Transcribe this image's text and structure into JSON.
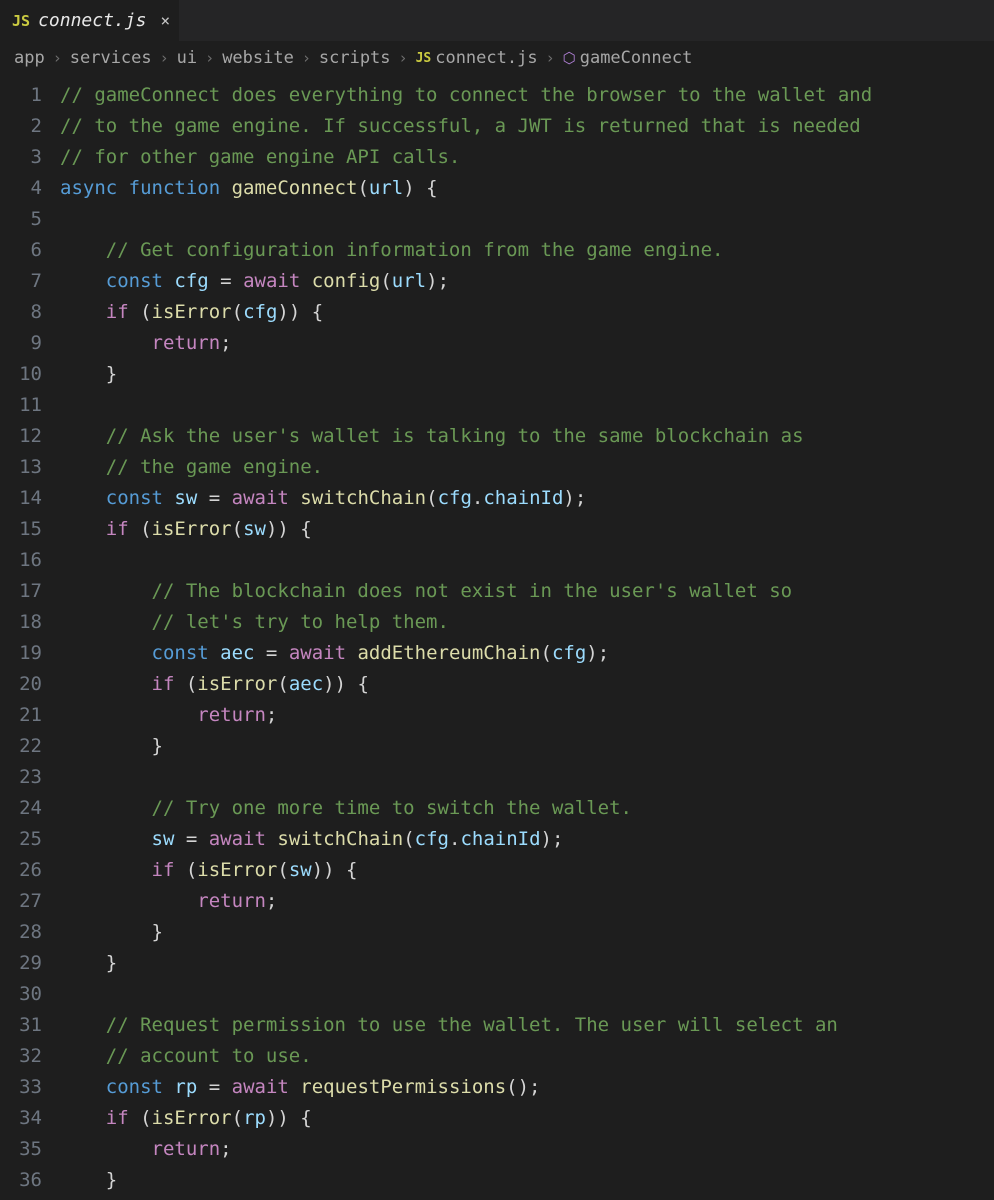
{
  "tab": {
    "icon_label": "JS",
    "filename": "connect.js",
    "close_glyph": "×"
  },
  "breadcrumbs": {
    "sep": "›",
    "parts": [
      "app",
      "services",
      "ui",
      "website",
      "scripts"
    ],
    "file_icon": "JS",
    "file": "connect.js",
    "symbol_icon": "⬡",
    "symbol": "gameConnect"
  },
  "code": {
    "lines": [
      {
        "n": 1,
        "tokens": [
          {
            "c": "tok-comment",
            "t": "// gameConnect does everything to connect the browser to the wallet and"
          }
        ]
      },
      {
        "n": 2,
        "tokens": [
          {
            "c": "tok-comment",
            "t": "// to the game engine. If successful, a JWT is returned that is needed"
          }
        ]
      },
      {
        "n": 3,
        "tokens": [
          {
            "c": "tok-comment",
            "t": "// for other game engine API calls."
          }
        ]
      },
      {
        "n": 4,
        "tokens": [
          {
            "c": "tok-keyword",
            "t": "async "
          },
          {
            "c": "tok-keyword",
            "t": "function "
          },
          {
            "c": "tok-func",
            "t": "gameConnect"
          },
          {
            "c": "tok-punct",
            "t": "("
          },
          {
            "c": "tok-ident",
            "t": "url"
          },
          {
            "c": "tok-punct",
            "t": ") {"
          }
        ]
      },
      {
        "n": 5,
        "tokens": [
          {
            "c": "tok-punct",
            "t": ""
          }
        ]
      },
      {
        "n": 6,
        "tokens": [
          {
            "c": "tok-punct",
            "t": "    "
          },
          {
            "c": "tok-comment",
            "t": "// Get configuration information from the game engine."
          }
        ]
      },
      {
        "n": 7,
        "tokens": [
          {
            "c": "tok-punct",
            "t": "    "
          },
          {
            "c": "tok-keyword",
            "t": "const "
          },
          {
            "c": "tok-ident",
            "t": "cfg"
          },
          {
            "c": "tok-punct",
            "t": " = "
          },
          {
            "c": "tok-storage",
            "t": "await "
          },
          {
            "c": "tok-func",
            "t": "config"
          },
          {
            "c": "tok-punct",
            "t": "("
          },
          {
            "c": "tok-ident",
            "t": "url"
          },
          {
            "c": "tok-punct",
            "t": ");"
          }
        ]
      },
      {
        "n": 8,
        "tokens": [
          {
            "c": "tok-punct",
            "t": "    "
          },
          {
            "c": "tok-storage",
            "t": "if "
          },
          {
            "c": "tok-punct",
            "t": "("
          },
          {
            "c": "tok-func",
            "t": "isError"
          },
          {
            "c": "tok-punct",
            "t": "("
          },
          {
            "c": "tok-ident",
            "t": "cfg"
          },
          {
            "c": "tok-punct",
            "t": ")) {"
          }
        ]
      },
      {
        "n": 9,
        "tokens": [
          {
            "c": "tok-punct",
            "t": "        "
          },
          {
            "c": "tok-storage",
            "t": "return"
          },
          {
            "c": "tok-punct",
            "t": ";"
          }
        ]
      },
      {
        "n": 10,
        "tokens": [
          {
            "c": "tok-punct",
            "t": "    }"
          }
        ]
      },
      {
        "n": 11,
        "tokens": [
          {
            "c": "tok-punct",
            "t": ""
          }
        ]
      },
      {
        "n": 12,
        "tokens": [
          {
            "c": "tok-punct",
            "t": "    "
          },
          {
            "c": "tok-comment",
            "t": "// Ask the user's wallet is talking to the same blockchain as"
          }
        ]
      },
      {
        "n": 13,
        "tokens": [
          {
            "c": "tok-punct",
            "t": "    "
          },
          {
            "c": "tok-comment",
            "t": "// the game engine."
          }
        ]
      },
      {
        "n": 14,
        "tokens": [
          {
            "c": "tok-punct",
            "t": "    "
          },
          {
            "c": "tok-keyword",
            "t": "const "
          },
          {
            "c": "tok-ident",
            "t": "sw"
          },
          {
            "c": "tok-punct",
            "t": " = "
          },
          {
            "c": "tok-storage",
            "t": "await "
          },
          {
            "c": "tok-func",
            "t": "switchChain"
          },
          {
            "c": "tok-punct",
            "t": "("
          },
          {
            "c": "tok-ident",
            "t": "cfg"
          },
          {
            "c": "tok-punct",
            "t": "."
          },
          {
            "c": "tok-prop",
            "t": "chainId"
          },
          {
            "c": "tok-punct",
            "t": ");"
          }
        ]
      },
      {
        "n": 15,
        "tokens": [
          {
            "c": "tok-punct",
            "t": "    "
          },
          {
            "c": "tok-storage",
            "t": "if "
          },
          {
            "c": "tok-punct",
            "t": "("
          },
          {
            "c": "tok-func",
            "t": "isError"
          },
          {
            "c": "tok-punct",
            "t": "("
          },
          {
            "c": "tok-ident",
            "t": "sw"
          },
          {
            "c": "tok-punct",
            "t": ")) {"
          }
        ]
      },
      {
        "n": 16,
        "tokens": [
          {
            "c": "tok-punct",
            "t": ""
          }
        ]
      },
      {
        "n": 17,
        "tokens": [
          {
            "c": "tok-punct",
            "t": "        "
          },
          {
            "c": "tok-comment",
            "t": "// The blockchain does not exist in the user's wallet so"
          }
        ]
      },
      {
        "n": 18,
        "tokens": [
          {
            "c": "tok-punct",
            "t": "        "
          },
          {
            "c": "tok-comment",
            "t": "// let's try to help them."
          }
        ]
      },
      {
        "n": 19,
        "tokens": [
          {
            "c": "tok-punct",
            "t": "        "
          },
          {
            "c": "tok-keyword",
            "t": "const "
          },
          {
            "c": "tok-ident",
            "t": "aec"
          },
          {
            "c": "tok-punct",
            "t": " = "
          },
          {
            "c": "tok-storage",
            "t": "await "
          },
          {
            "c": "tok-func",
            "t": "addEthereumChain"
          },
          {
            "c": "tok-punct",
            "t": "("
          },
          {
            "c": "tok-ident",
            "t": "cfg"
          },
          {
            "c": "tok-punct",
            "t": ");"
          }
        ]
      },
      {
        "n": 20,
        "tokens": [
          {
            "c": "tok-punct",
            "t": "        "
          },
          {
            "c": "tok-storage",
            "t": "if "
          },
          {
            "c": "tok-punct",
            "t": "("
          },
          {
            "c": "tok-func",
            "t": "isError"
          },
          {
            "c": "tok-punct",
            "t": "("
          },
          {
            "c": "tok-ident",
            "t": "aec"
          },
          {
            "c": "tok-punct",
            "t": ")) {"
          }
        ]
      },
      {
        "n": 21,
        "tokens": [
          {
            "c": "tok-punct",
            "t": "            "
          },
          {
            "c": "tok-storage",
            "t": "return"
          },
          {
            "c": "tok-punct",
            "t": ";"
          }
        ]
      },
      {
        "n": 22,
        "tokens": [
          {
            "c": "tok-punct",
            "t": "        }"
          }
        ]
      },
      {
        "n": 23,
        "tokens": [
          {
            "c": "tok-punct",
            "t": ""
          }
        ]
      },
      {
        "n": 24,
        "tokens": [
          {
            "c": "tok-punct",
            "t": "        "
          },
          {
            "c": "tok-comment",
            "t": "// Try one more time to switch the wallet."
          }
        ]
      },
      {
        "n": 25,
        "tokens": [
          {
            "c": "tok-punct",
            "t": "        "
          },
          {
            "c": "tok-ident",
            "t": "sw"
          },
          {
            "c": "tok-punct",
            "t": " = "
          },
          {
            "c": "tok-storage",
            "t": "await "
          },
          {
            "c": "tok-func",
            "t": "switchChain"
          },
          {
            "c": "tok-punct",
            "t": "("
          },
          {
            "c": "tok-ident",
            "t": "cfg"
          },
          {
            "c": "tok-punct",
            "t": "."
          },
          {
            "c": "tok-prop",
            "t": "chainId"
          },
          {
            "c": "tok-punct",
            "t": ");"
          }
        ]
      },
      {
        "n": 26,
        "tokens": [
          {
            "c": "tok-punct",
            "t": "        "
          },
          {
            "c": "tok-storage",
            "t": "if "
          },
          {
            "c": "tok-punct",
            "t": "("
          },
          {
            "c": "tok-func",
            "t": "isError"
          },
          {
            "c": "tok-punct",
            "t": "("
          },
          {
            "c": "tok-ident",
            "t": "sw"
          },
          {
            "c": "tok-punct",
            "t": ")) {"
          }
        ]
      },
      {
        "n": 27,
        "tokens": [
          {
            "c": "tok-punct",
            "t": "            "
          },
          {
            "c": "tok-storage",
            "t": "return"
          },
          {
            "c": "tok-punct",
            "t": ";"
          }
        ]
      },
      {
        "n": 28,
        "tokens": [
          {
            "c": "tok-punct",
            "t": "        }"
          }
        ]
      },
      {
        "n": 29,
        "tokens": [
          {
            "c": "tok-punct",
            "t": "    }"
          }
        ]
      },
      {
        "n": 30,
        "tokens": [
          {
            "c": "tok-punct",
            "t": ""
          }
        ]
      },
      {
        "n": 31,
        "tokens": [
          {
            "c": "tok-punct",
            "t": "    "
          },
          {
            "c": "tok-comment",
            "t": "// Request permission to use the wallet. The user will select an"
          }
        ]
      },
      {
        "n": 32,
        "tokens": [
          {
            "c": "tok-punct",
            "t": "    "
          },
          {
            "c": "tok-comment",
            "t": "// account to use."
          }
        ]
      },
      {
        "n": 33,
        "tokens": [
          {
            "c": "tok-punct",
            "t": "    "
          },
          {
            "c": "tok-keyword",
            "t": "const "
          },
          {
            "c": "tok-ident",
            "t": "rp"
          },
          {
            "c": "tok-punct",
            "t": " = "
          },
          {
            "c": "tok-storage",
            "t": "await "
          },
          {
            "c": "tok-func",
            "t": "requestPermissions"
          },
          {
            "c": "tok-punct",
            "t": "();"
          }
        ]
      },
      {
        "n": 34,
        "tokens": [
          {
            "c": "tok-punct",
            "t": "    "
          },
          {
            "c": "tok-storage",
            "t": "if "
          },
          {
            "c": "tok-punct",
            "t": "("
          },
          {
            "c": "tok-func",
            "t": "isError"
          },
          {
            "c": "tok-punct",
            "t": "("
          },
          {
            "c": "tok-ident",
            "t": "rp"
          },
          {
            "c": "tok-punct",
            "t": ")) {"
          }
        ]
      },
      {
        "n": 35,
        "tokens": [
          {
            "c": "tok-punct",
            "t": "        "
          },
          {
            "c": "tok-storage",
            "t": "return"
          },
          {
            "c": "tok-punct",
            "t": ";"
          }
        ]
      },
      {
        "n": 36,
        "tokens": [
          {
            "c": "tok-punct",
            "t": "    }"
          }
        ]
      }
    ]
  }
}
